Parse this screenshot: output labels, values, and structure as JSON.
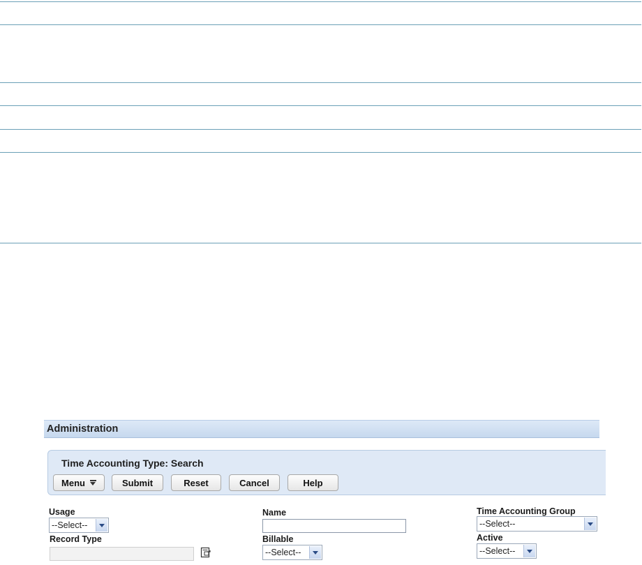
{
  "admin": {
    "title": "Administration"
  },
  "panel": {
    "title": "Time Accounting Type: Search"
  },
  "toolbar": {
    "menu_label": "Menu",
    "submit_label": "Submit",
    "reset_label": "Reset",
    "cancel_label": "Cancel",
    "help_label": "Help"
  },
  "form": {
    "usage": {
      "label": "Usage",
      "value": "--Select--"
    },
    "record_type": {
      "label": "Record Type",
      "value": ""
    },
    "name": {
      "label": "Name",
      "value": ""
    },
    "billable": {
      "label": "Billable",
      "value": "--Select--"
    },
    "time_accounting_group": {
      "label": "Time Accounting Group",
      "value": "--Select--"
    },
    "active": {
      "label": "Active",
      "value": "--Select--"
    }
  },
  "icons": {
    "lookup": "lookup-icon",
    "menu_dropdown": "menu-dropdown-icon",
    "select_arrow": "chevron-down-icon"
  },
  "colors": {
    "rule": "#6a9fb6",
    "panel_bg": "#dfe9f6",
    "header_bg": "#c6d8ee"
  }
}
